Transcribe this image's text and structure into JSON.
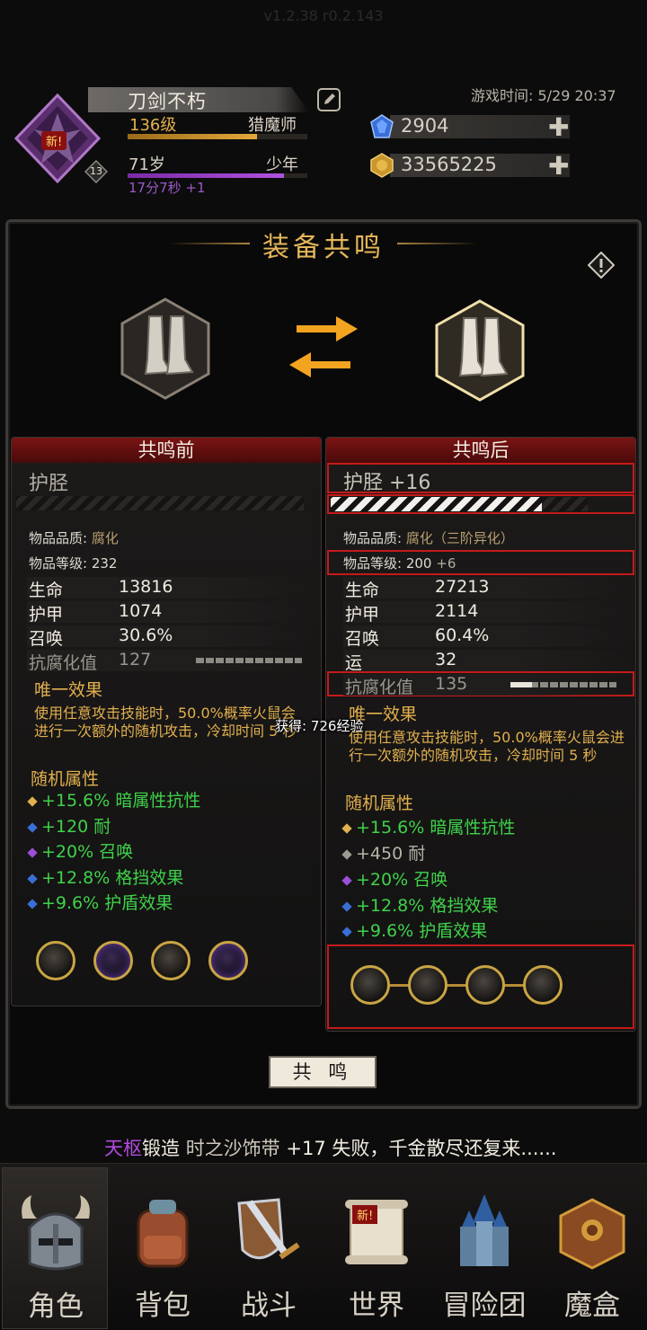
{
  "header": {
    "version": "v1.2.38 r0.2.143",
    "new_badge": "新!",
    "avatar_level": "13",
    "player_name": "刀剑不朽",
    "level": "136级",
    "class": "猎魔师",
    "age": "71岁",
    "life_stage": "少年",
    "age_timer": "17分7秒 +1",
    "game_time": "游戏时间: 5/29 20:37",
    "gems": "2904",
    "gold": "33565225",
    "xp_progress": 0.72,
    "age_progress": 0.87
  },
  "panel": {
    "title": "装备共鸣",
    "resonate_button": "共 鸣",
    "toast": "获得: 726经验"
  },
  "before": {
    "header": "共鸣前",
    "item_name": "护胫",
    "quality_label": "物品品质:",
    "quality": "腐化",
    "level_label": "物品等级:",
    "level": "232",
    "stats": [
      {
        "key": "生命",
        "value": "13816"
      },
      {
        "key": "护甲",
        "value": "1074"
      },
      {
        "key": "召唤",
        "value": "30.6%"
      }
    ],
    "corruption": {
      "key": "抗腐化值",
      "value": "127",
      "fill": 0.0
    },
    "unique_title": "唯一效果",
    "unique_desc": "使用任意攻击技能时，50.0%概率火鼠会进行一次额外的随机攻击，冷却时间 5 秒",
    "random_title": "随机属性",
    "attrs": [
      {
        "text": "+15.6% 暗属性抗性",
        "dot": "#e2b04e"
      },
      {
        "text": "+120 耐",
        "dot": "#3a6fd8"
      },
      {
        "text": "+20% 召唤",
        "dot": "#9b4fd8"
      },
      {
        "text": "+12.8% 格挡效果",
        "dot": "#3a6fd8"
      },
      {
        "text": "+9.6% 护盾效果",
        "dot": "#3a6fd8"
      }
    ]
  },
  "after": {
    "header": "共鸣后",
    "item_name": "护胫 +16",
    "enhance_progress": 0.82,
    "quality_label": "物品品质:",
    "quality": "腐化（三阶异化）",
    "level_label": "物品等级:",
    "level": "200",
    "level_bonus": "+6",
    "stats": [
      {
        "key": "生命",
        "value": "27213"
      },
      {
        "key": "护甲",
        "value": "2114"
      },
      {
        "key": "召唤",
        "value": "60.4%"
      },
      {
        "key": "运",
        "value": "32"
      }
    ],
    "corruption": {
      "key": "抗腐化值",
      "value": "135",
      "fill": 0.2
    },
    "unique_title": "唯一效果",
    "unique_desc": "使用任意攻击技能时，50.0%概率火鼠会进行一次额外的随机攻击，冷却时间 5 秒",
    "random_title": "随机属性",
    "attrs": [
      {
        "text": "+15.6% 暗属性抗性",
        "dot": "#e2b04e",
        "color": "green"
      },
      {
        "text": "+450 耐",
        "dot": "#9e9a92",
        "color": "gray"
      },
      {
        "text": "+20% 召唤",
        "dot": "#9b4fd8",
        "color": "green"
      },
      {
        "text": "+12.8% 格挡效果",
        "dot": "#3a6fd8",
        "color": "green"
      },
      {
        "text": "+9.6% 护盾效果",
        "dot": "#3a6fd8",
        "color": "green"
      }
    ]
  },
  "ticker": {
    "name": "天枢",
    "verb": "锻造",
    "item": "时之沙饰带",
    "level": "+17",
    "result": "失败，千金散尽还复来......"
  },
  "nav": {
    "items": [
      "角色",
      "背包",
      "战斗",
      "世界",
      "冒险团",
      "魔盒"
    ],
    "new_badge": "新!"
  },
  "colors": {
    "accent_gold": "#e5b65b",
    "highlight_red": "#c41a1a",
    "stat_green": "#3fd24a"
  }
}
